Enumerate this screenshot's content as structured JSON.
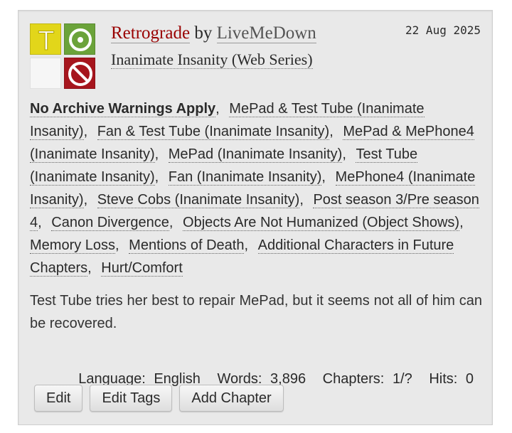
{
  "work": {
    "title": "Retrograde",
    "by": "by",
    "author": "LiveMeDown",
    "fandom": "Inanimate Insanity (Web Series)",
    "date": "22 Aug 2025",
    "required_tags": {
      "rating": {
        "letter": "T",
        "meaning": "Teen And Up Audiences",
        "color": "#e2d61a"
      },
      "category": {
        "icon": "circle-target-icon",
        "color": "#6ba33a"
      },
      "completion": {
        "color": "#f6f6f6"
      },
      "warnings": {
        "icon": "no-sign-icon",
        "color": "#a6151d"
      }
    }
  },
  "tags": [
    {
      "text": "No Archive Warnings Apply",
      "kind": "warning"
    },
    {
      "text": "MePad & Test Tube (Inanimate Insanity)",
      "kind": "relationship"
    },
    {
      "text": "Fan & Test Tube (Inanimate Insanity)",
      "kind": "relationship"
    },
    {
      "text": "MePad & MePhone4 (Inanimate Insanity)",
      "kind": "relationship"
    },
    {
      "text": "MePad (Inanimate Insanity)",
      "kind": "character"
    },
    {
      "text": "Test Tube (Inanimate Insanity)",
      "kind": "character"
    },
    {
      "text": "Fan (Inanimate Insanity)",
      "kind": "character"
    },
    {
      "text": "MePhone4 (Inanimate Insanity)",
      "kind": "character"
    },
    {
      "text": "Steve Cobs (Inanimate Insanity)",
      "kind": "character"
    },
    {
      "text": "Post season 3/Pre season 4",
      "kind": "freeform"
    },
    {
      "text": "Canon Divergence",
      "kind": "freeform"
    },
    {
      "text": "Objects Are Not Humanized (Object Shows)",
      "kind": "freeform"
    },
    {
      "text": "Memory Loss",
      "kind": "freeform"
    },
    {
      "text": "Mentions of Death",
      "kind": "freeform"
    },
    {
      "text": "Additional Characters in Future Chapters",
      "kind": "freeform"
    },
    {
      "text": "Hurt/Comfort",
      "kind": "freeform"
    }
  ],
  "summary": "Test Tube tries her best to repair MePad, but it seems not all of him can be recovered.",
  "stats": {
    "language_label": "Language:",
    "language": "English",
    "words_label": "Words:",
    "words": "3,896",
    "chapters_label": "Chapters:",
    "chapters": "1/?",
    "hits_label": "Hits:",
    "hits": "0"
  },
  "actions": {
    "edit": "Edit",
    "edit_tags": "Edit Tags",
    "add_chapter": "Add Chapter"
  }
}
